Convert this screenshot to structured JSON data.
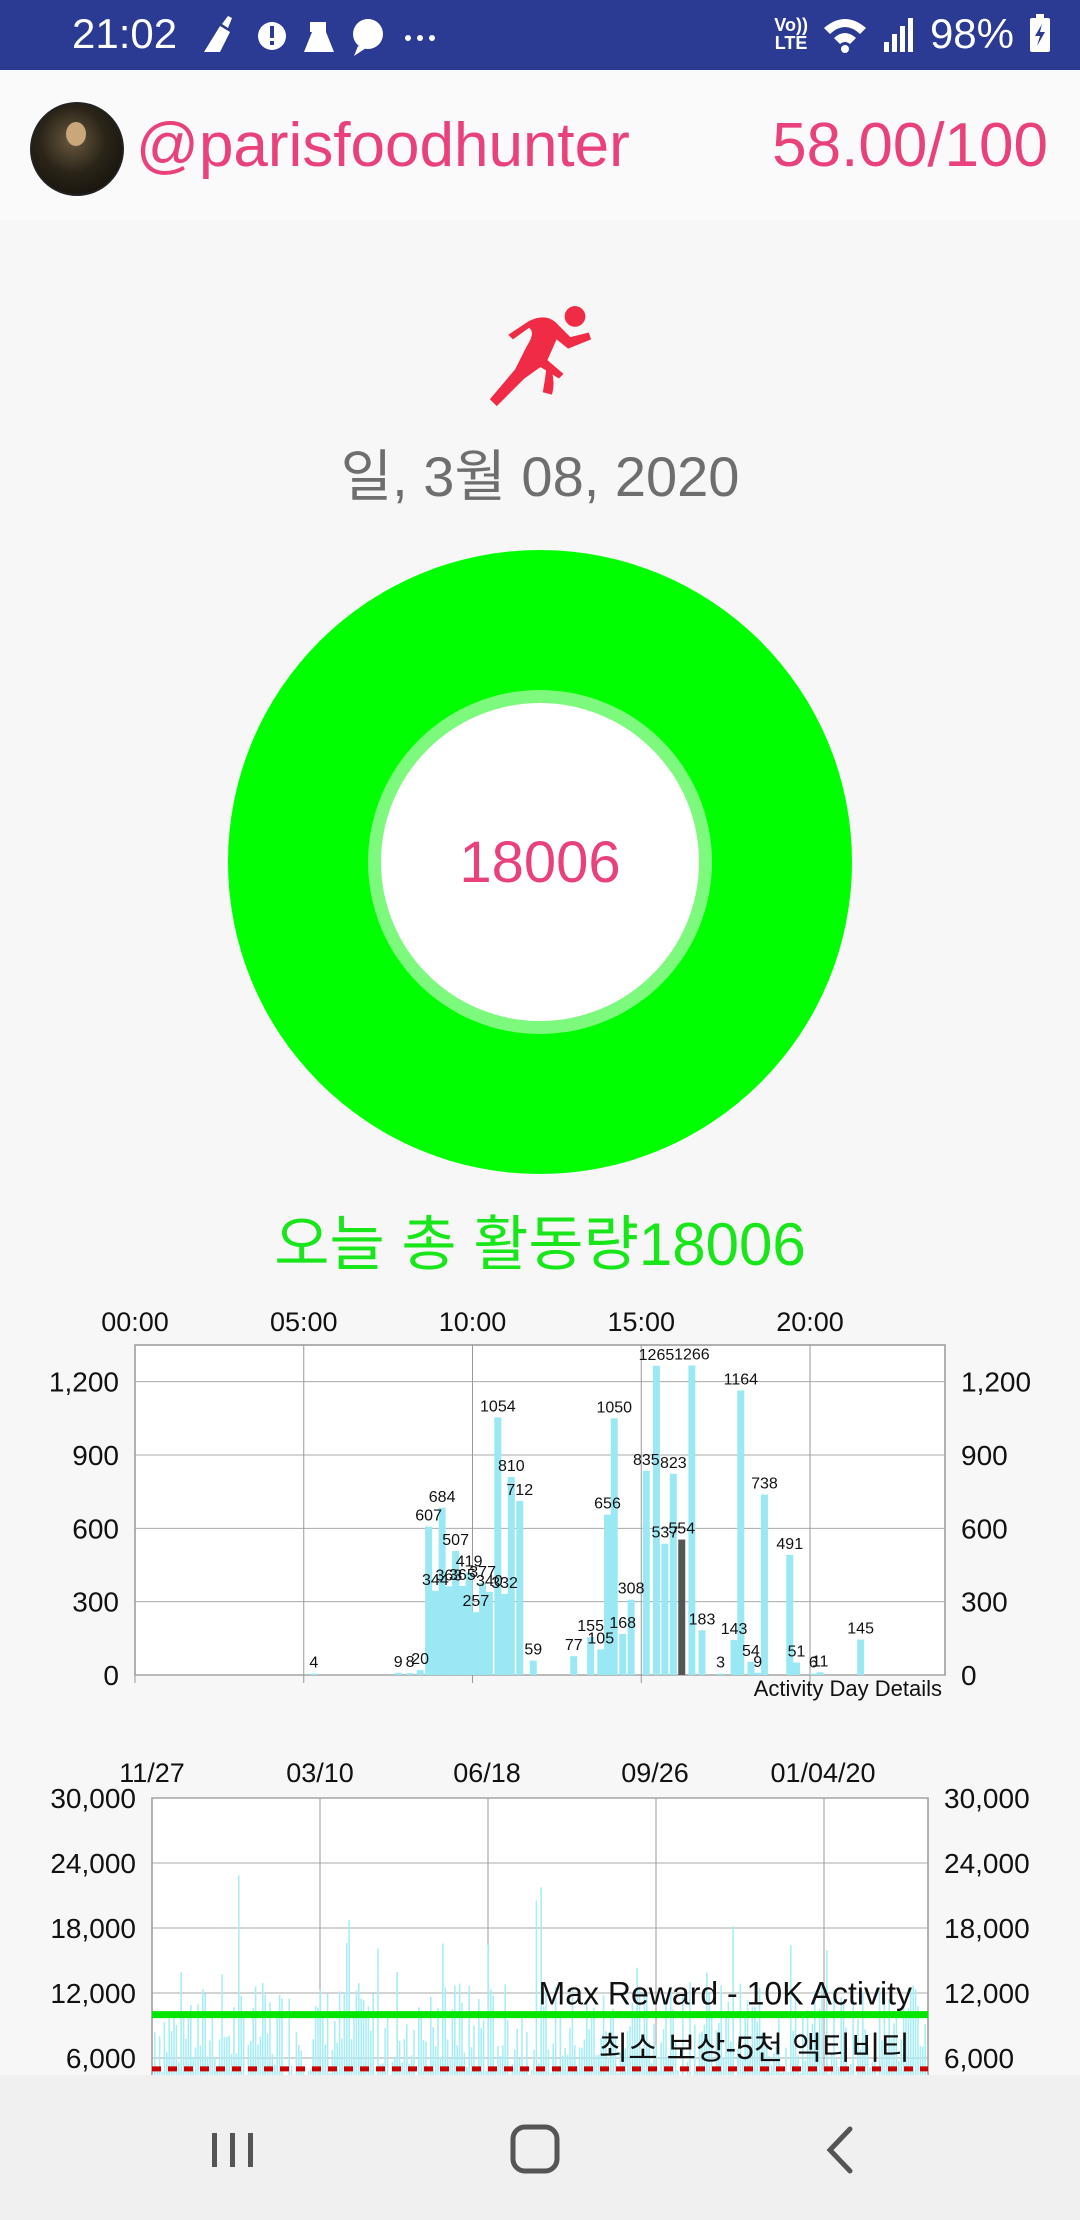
{
  "status_bar": {
    "time": "21:02",
    "battery": "98%",
    "network_label": "LTE",
    "network_prefix": "Vo))"
  },
  "header": {
    "username": "@parisfoodhunter",
    "score": "58.00/100"
  },
  "activity": {
    "icon": "running-person-icon",
    "date": "일, 3월 08, 2020",
    "donut_value": "18006",
    "total_label": "오늘 총 활동량18006",
    "accent_color": "#00ff00",
    "value_color": "#e8417b"
  },
  "chart_data": [
    {
      "type": "bar",
      "x_tick_labels": [
        "00:00",
        "05:00",
        "10:00",
        "15:00",
        "20:00"
      ],
      "y_tick_labels": [
        "1,200",
        "900",
        "600",
        "300",
        "0"
      ],
      "ylim": [
        0,
        1350
      ],
      "xlim": [
        0,
        24
      ],
      "annotation": "Activity Day Details",
      "highlight_color": "#555555",
      "bar_color": "#9be8f5",
      "bars": [
        {
          "x": 5.3,
          "value": 4,
          "label": "4"
        },
        {
          "x": 7.8,
          "value": 9,
          "label": "9"
        },
        {
          "x": 8.15,
          "value": 8,
          "label": "8"
        },
        {
          "x": 8.45,
          "value": 20,
          "label": "20"
        },
        {
          "x": 8.7,
          "value": 607,
          "label": "607"
        },
        {
          "x": 8.9,
          "value": 344,
          "label": "344"
        },
        {
          "x": 9.1,
          "value": 684,
          "label": "684"
        },
        {
          "x": 9.3,
          "value": 363,
          "label": "363"
        },
        {
          "x": 9.5,
          "value": 507,
          "label": "507"
        },
        {
          "x": 9.7,
          "value": 365,
          "label": "365"
        },
        {
          "x": 9.9,
          "value": 419,
          "label": "419"
        },
        {
          "x": 10.1,
          "value": 257,
          "label": "257"
        },
        {
          "x": 10.3,
          "value": 377,
          "label": "377"
        },
        {
          "x": 10.5,
          "value": 340,
          "label": "340"
        },
        {
          "x": 10.75,
          "value": 1054,
          "label": "1054"
        },
        {
          "x": 10.95,
          "value": 332,
          "label": "332"
        },
        {
          "x": 11.15,
          "value": 810,
          "label": "810"
        },
        {
          "x": 11.4,
          "value": 712,
          "label": "712"
        },
        {
          "x": 11.8,
          "value": 59,
          "label": "59"
        },
        {
          "x": 13.0,
          "value": 77,
          "label": "77"
        },
        {
          "x": 13.5,
          "value": 155,
          "label": "155"
        },
        {
          "x": 13.8,
          "value": 105,
          "label": "105"
        },
        {
          "x": 14.0,
          "value": 656,
          "label": "656"
        },
        {
          "x": 14.2,
          "value": 1050,
          "label": "1050"
        },
        {
          "x": 14.45,
          "value": 168,
          "label": "168"
        },
        {
          "x": 14.7,
          "value": 308,
          "label": "308"
        },
        {
          "x": 15.15,
          "value": 835,
          "label": "835"
        },
        {
          "x": 15.45,
          "value": 1265,
          "label": "1265"
        },
        {
          "x": 15.7,
          "value": 537,
          "label": "537"
        },
        {
          "x": 15.95,
          "value": 823,
          "label": "823"
        },
        {
          "x": 16.2,
          "value": 554,
          "label": "554",
          "highlight": true
        },
        {
          "x": 16.5,
          "value": 1266,
          "label": "1266"
        },
        {
          "x": 16.8,
          "value": 183,
          "label": "183"
        },
        {
          "x": 17.35,
          "value": 3,
          "label": "3"
        },
        {
          "x": 17.75,
          "value": 143,
          "label": "143"
        },
        {
          "x": 17.95,
          "value": 1164,
          "label": "1164"
        },
        {
          "x": 18.25,
          "value": 54,
          "label": "54"
        },
        {
          "x": 18.45,
          "value": 9,
          "label": "9"
        },
        {
          "x": 18.65,
          "value": 738,
          "label": "738"
        },
        {
          "x": 19.4,
          "value": 491,
          "label": "491"
        },
        {
          "x": 19.6,
          "value": 51,
          "label": "51"
        },
        {
          "x": 20.1,
          "value": 6,
          "label": "6"
        },
        {
          "x": 20.3,
          "value": 11,
          "label": "11"
        },
        {
          "x": 21.5,
          "value": 145,
          "label": "145"
        }
      ]
    },
    {
      "type": "bar",
      "x_tick_labels": [
        "11/27",
        "03/10",
        "06/18",
        "09/26",
        "01/04/20"
      ],
      "y_tick_labels": [
        "30,000",
        "24,000",
        "18,000",
        "12,000",
        "6,000"
      ],
      "ylim": [
        0,
        30000
      ],
      "reference_lines": [
        {
          "label": "Max Reward - 10K Activity",
          "value": 10000,
          "color": "#00e600",
          "style": "solid"
        },
        {
          "label": "최소 보상-5천 액티비티",
          "value": 5000,
          "color": "#cc0000",
          "style": "dotted"
        }
      ],
      "bar_color": "#a9eef7"
    }
  ],
  "nav_bar": {
    "items": [
      "recent-apps-icon",
      "home-icon",
      "back-icon"
    ]
  }
}
